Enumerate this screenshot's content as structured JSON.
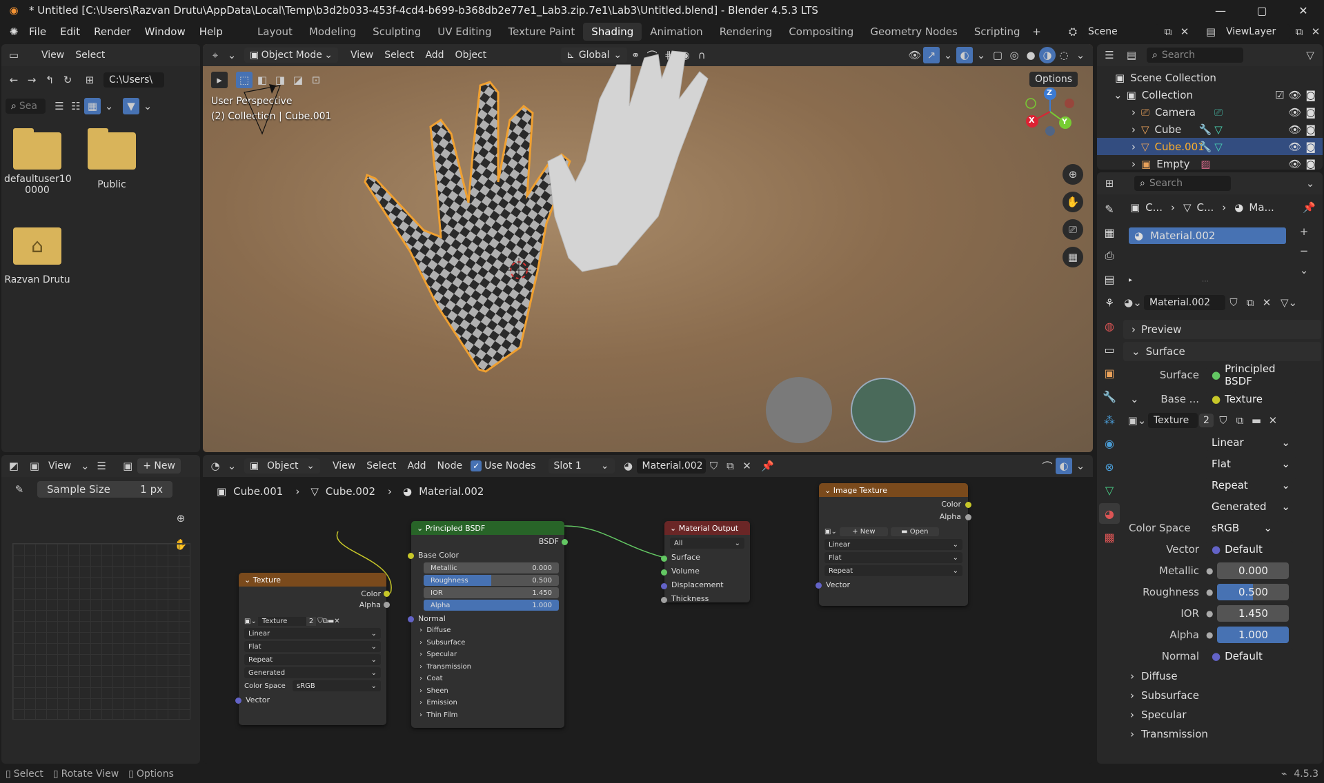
{
  "title_bar": {
    "title": "* Untitled [C:\\Users\\Razvan Drutu\\AppData\\Local\\Temp\\b3d2b033-453f-4cd4-b699-b368db2e77e1_Lab3.zip.7e1\\Lab3\\Untitled.blend] - Blender 4.5.3 LTS"
  },
  "menu": {
    "items": [
      "File",
      "Edit",
      "Render",
      "Window",
      "Help"
    ]
  },
  "workspaces": [
    "Layout",
    "Modeling",
    "Sculpting",
    "UV Editing",
    "Texture Paint",
    "Shading",
    "Animation",
    "Rendering",
    "Compositing",
    "Geometry Nodes",
    "Scripting"
  ],
  "active_workspace": "Shading",
  "scene": {
    "name": "Scene",
    "view_layer": "ViewLayer"
  },
  "file_browser": {
    "menus": [
      "View",
      "Select"
    ],
    "path": "C:\\Users\\",
    "search_placeholder": "Sea",
    "items": [
      {
        "name": "defaultuser10\n0000",
        "type": "folder"
      },
      {
        "name": "Public",
        "type": "folder"
      },
      {
        "name": "Razvan Drutu",
        "type": "home-folder"
      }
    ]
  },
  "viewport": {
    "mode": "Object Mode",
    "menus": [
      "View",
      "Select",
      "Add",
      "Object"
    ],
    "transform": "Global",
    "options": "Options",
    "overlay_line1": "User Perspective",
    "overlay_line2": "(2) Collection | Cube.001",
    "gizmo": {
      "x": "X",
      "y": "Y",
      "z": "Z"
    }
  },
  "image_editor": {
    "view": "View",
    "new": "New",
    "sample_label": "Sample Size",
    "sample_value": "1 px"
  },
  "node_editor": {
    "object": "Object",
    "menus": [
      "View",
      "Select",
      "Add",
      "Node"
    ],
    "use_nodes": "Use Nodes",
    "slot": "Slot 1",
    "material": "Material.002",
    "breadcrumb": [
      "Cube.001",
      "Cube.002",
      "Material.002"
    ],
    "texture_node": {
      "title": "Texture",
      "out_color": "Color",
      "out_alpha": "Alpha",
      "image": "Texture",
      "users": "2",
      "interp": "Linear",
      "proj": "Flat",
      "ext": "Repeat",
      "source": "Generated",
      "cs_label": "Color Space",
      "cs_value": "sRGB",
      "vector": "Vector"
    },
    "bsdf_node": {
      "title": "Principled BSDF",
      "out": "BSDF",
      "base_color": "Base Color",
      "metallic_label": "Metallic",
      "metallic": "0.000",
      "roughness_label": "Roughness",
      "roughness": "0.500",
      "ior_label": "IOR",
      "ior": "1.450",
      "alpha_label": "Alpha",
      "alpha": "1.000",
      "normal": "Normal",
      "panels": [
        "Diffuse",
        "Subsurface",
        "Specular",
        "Transmission",
        "Coat",
        "Sheen",
        "Emission",
        "Thin Film"
      ]
    },
    "output_node": {
      "title": "Material Output",
      "target": "All",
      "inputs": [
        "Surface",
        "Volume",
        "Displacement",
        "Thickness"
      ]
    },
    "image_node": {
      "title": "Image Texture",
      "out_color": "Color",
      "out_alpha": "Alpha",
      "new": "New",
      "open": "Open",
      "interp": "Linear",
      "proj": "Flat",
      "ext": "Repeat",
      "vector": "Vector"
    }
  },
  "outliner": {
    "search": "Search",
    "scene_collection": "Scene Collection",
    "collection": "Collection",
    "items": [
      {
        "name": "Camera",
        "selected": false
      },
      {
        "name": "Cube",
        "selected": false
      },
      {
        "name": "Cube.001",
        "selected": true
      },
      {
        "name": "Empty",
        "selected": false
      }
    ]
  },
  "properties": {
    "search": "Search",
    "crumbs": [
      "C...",
      "C...",
      "Ma..."
    ],
    "slot_material": "Material.002",
    "material_name": "Material.002",
    "sections": {
      "preview": "Preview",
      "surface": "Surface"
    },
    "surface_label": "Surface",
    "surface_value": "Principled BSDF",
    "base_label": "Base ...",
    "base_value": "Texture",
    "texture_name": "Texture",
    "texture_users": "2",
    "interp": "Linear",
    "proj": "Flat",
    "ext": "Repeat",
    "source": "Generated",
    "color_space_label": "Color Space",
    "color_space": "sRGB",
    "vector_label": "Vector",
    "vector_value": "Default",
    "metallic_label": "Metallic",
    "metallic": "0.000",
    "roughness_label": "Roughness",
    "roughness": "0.500",
    "ior_label": "IOR",
    "ior": "1.450",
    "alpha_label": "Alpha",
    "alpha": "1.000",
    "normal_label": "Normal",
    "normal_value": "Default",
    "subpanels": [
      "Diffuse",
      "Subsurface",
      "Specular",
      "Transmission"
    ]
  },
  "status_bar": {
    "select": "Select",
    "rotate": "Rotate View",
    "options": "Options",
    "version": "4.5.3"
  },
  "colors": {
    "accent": "#4772b3",
    "texture_header": "#7a4a1c",
    "shader_header": "#286428",
    "output_header": "#6a2626",
    "selection_orange": "#f0a030"
  }
}
